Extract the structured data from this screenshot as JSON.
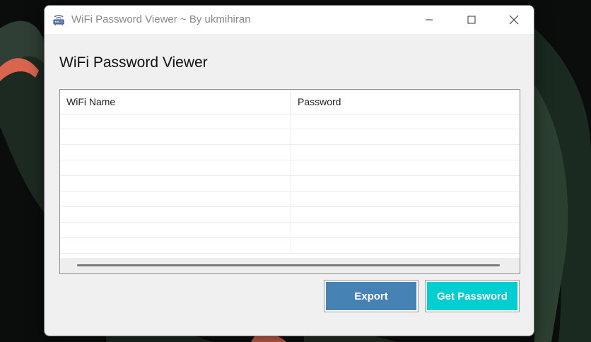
{
  "window": {
    "title": "WiFi Password Viewer ~ By ukmihiran",
    "icon": "wifi-router-icon"
  },
  "caption_buttons": {
    "minimize_icon": "minimize-icon",
    "maximize_icon": "maximize-icon",
    "close_icon": "close-icon"
  },
  "main": {
    "heading": "WiFi Password Viewer"
  },
  "listview": {
    "columns": [
      "WiFi Name",
      "Password"
    ],
    "rows": [
      [
        "",
        ""
      ],
      [
        "",
        ""
      ],
      [
        "",
        ""
      ],
      [
        "",
        ""
      ],
      [
        "",
        ""
      ],
      [
        "",
        ""
      ],
      [
        "",
        ""
      ],
      [
        "",
        ""
      ],
      [
        "",
        ""
      ]
    ]
  },
  "buttons": {
    "export_label": "Export",
    "get_password_label": "Get Password"
  },
  "colors": {
    "export": "#4682b4",
    "get_password": "#00ced1"
  }
}
